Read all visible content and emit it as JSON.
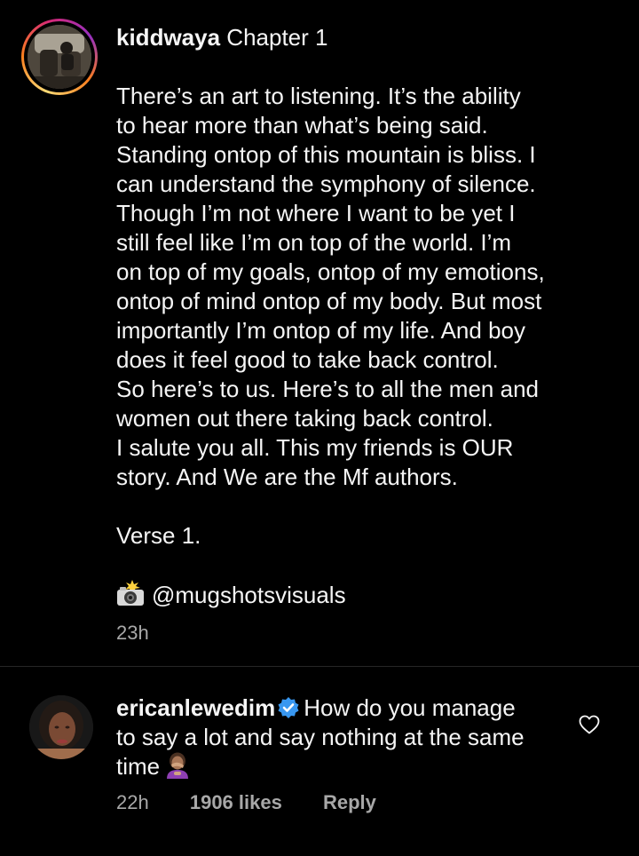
{
  "post": {
    "author": "kiddwaya",
    "title": "Chapter 1",
    "caption_lines": [
      "There’s an art to listening. It’s the ability",
      "to hear more than what’s being said.",
      "Standing ontop of this mountain is bliss. I",
      "can understand the symphony of silence.",
      "Though I’m not where I want to be yet I",
      "still feel like I’m on top of the world. I’m",
      "on top of my goals, ontop of my emotions,",
      "ontop of mind ontop of my body. But most",
      "importantly I’m ontop of my life. And boy",
      "does it feel good to take back control.",
      "So here’s to us. Here’s to all the men and",
      "women out there taking back control.",
      "I salute you all. This my friends is OUR",
      "story. And We are the Mf authors."
    ],
    "verse": "Verse 1.",
    "credit_mention": "@mugshotsvisuals",
    "credit_icon": "camera-flash-icon",
    "time_ago": "23h"
  },
  "comment": {
    "username": "ericanlewedim",
    "verified_icon": "verified-badge-icon",
    "text_lines": [
      "How do you manage",
      "to say a lot and say nothing at the same",
      "time"
    ],
    "emoji_icon": "person-facepalming-icon",
    "time_ago": "22h",
    "likes": "1906 likes",
    "reply_label": "Reply",
    "like_icon": "heart-outline-icon"
  },
  "colors": {
    "background": "#000000",
    "text": "#f5f5f5",
    "secondary_text": "#a8a8a8",
    "divider": "#262626",
    "verified_blue": "#3897f0"
  }
}
